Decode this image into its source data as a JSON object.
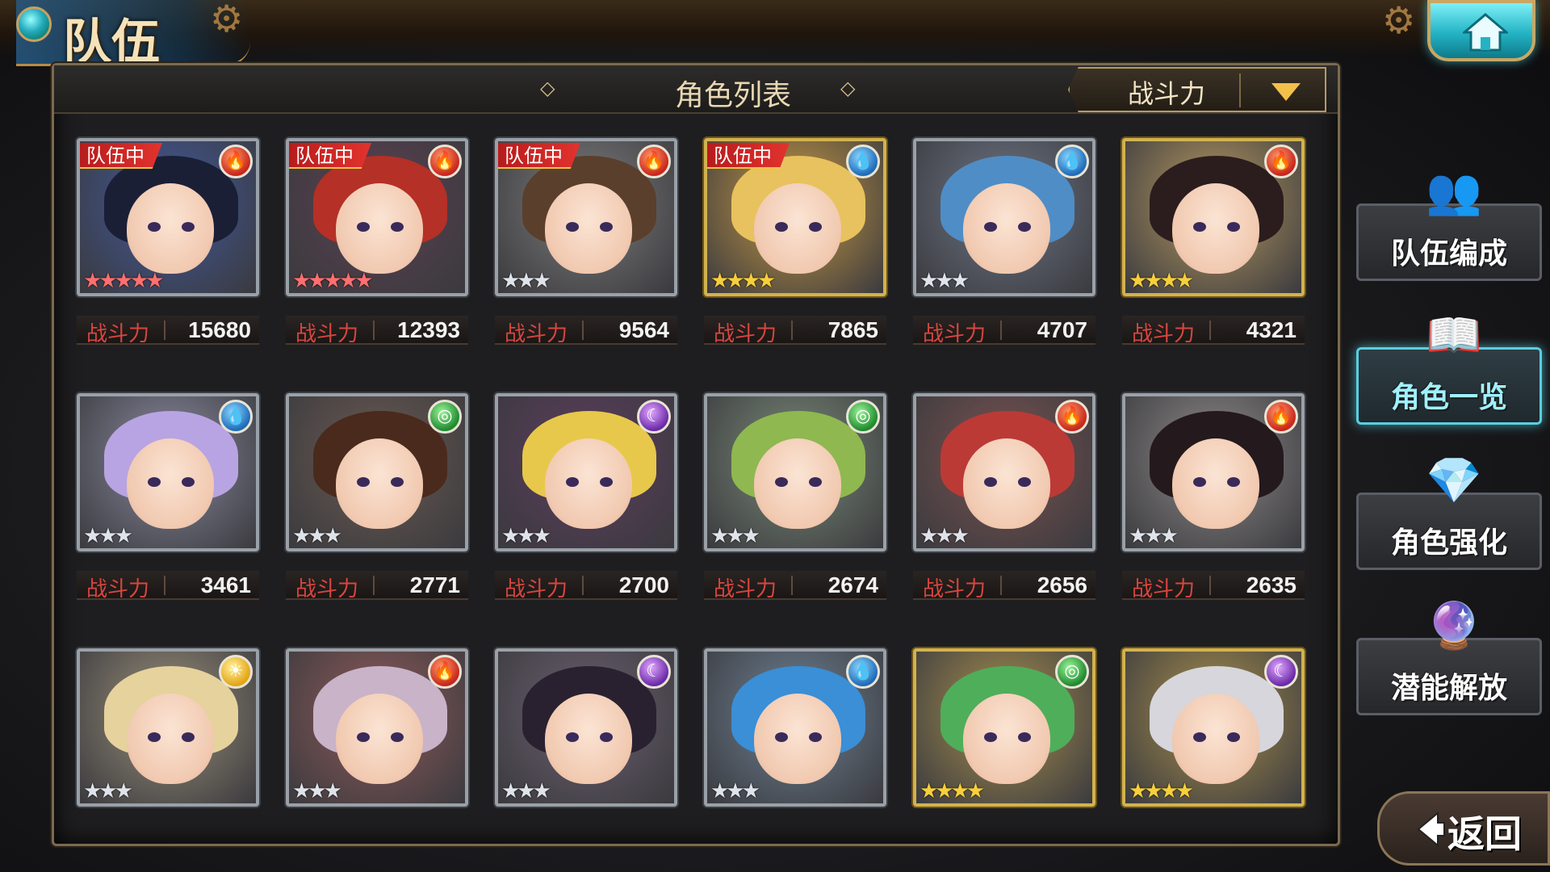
{
  "header": {
    "title": "队伍"
  },
  "panel": {
    "title": "角色列表",
    "sort_label": "战斗力"
  },
  "power_label": "战斗力",
  "team_tag": "队伍中",
  "rows": [
    [
      {
        "power": "15680",
        "in_team": true,
        "element": "fire",
        "stars": 5,
        "rarity": "rainbow",
        "hair": "#1a1f36",
        "bg": "#41589a"
      },
      {
        "power": "12393",
        "in_team": true,
        "element": "fire",
        "stars": 5,
        "rarity": "rainbow",
        "hair": "#b53026",
        "bg": "#5a4050"
      },
      {
        "power": "9564",
        "in_team": true,
        "element": "fire",
        "stars": 3,
        "rarity": "silver",
        "hair": "#5a3f2c",
        "bg": "#7c7c7c"
      },
      {
        "power": "7865",
        "in_team": true,
        "element": "water",
        "stars": 4,
        "rarity": "gold",
        "hair": "#e8c25e",
        "bg": "#c89a45"
      },
      {
        "power": "4707",
        "in_team": false,
        "element": "water",
        "stars": 3,
        "rarity": "silver",
        "hair": "#4f8dc6",
        "bg": "#6d7585"
      },
      {
        "power": "4321",
        "in_team": false,
        "element": "fire",
        "stars": 4,
        "rarity": "gold",
        "hair": "#2b1d1d",
        "bg": "#b79a62"
      }
    ],
    [
      {
        "power": "3461",
        "in_team": false,
        "element": "water",
        "stars": 3,
        "rarity": "silver",
        "hair": "#b8a4e2",
        "bg": "#8a8aa0"
      },
      {
        "power": "2771",
        "in_team": false,
        "element": "wind",
        "stars": 3,
        "rarity": "silver",
        "hair": "#4a2a1c",
        "bg": "#6a5a52"
      },
      {
        "power": "2700",
        "in_team": false,
        "element": "dark",
        "stars": 3,
        "rarity": "silver",
        "hair": "#e7c84a",
        "bg": "#5d3c5e"
      },
      {
        "power": "2674",
        "in_team": false,
        "element": "wind",
        "stars": 3,
        "rarity": "silver",
        "hair": "#8fb850",
        "bg": "#7a8a78"
      },
      {
        "power": "2656",
        "in_team": false,
        "element": "fire",
        "stars": 3,
        "rarity": "silver",
        "hair": "#bb3a36",
        "bg": "#7a5250"
      },
      {
        "power": "2635",
        "in_team": false,
        "element": "fire",
        "stars": 3,
        "rarity": "silver",
        "hair": "#24191c",
        "bg": "#8e8a88"
      }
    ],
    [
      {
        "in_team": false,
        "element": "light",
        "stars": 3,
        "rarity": "silver",
        "hair": "#e6d29c",
        "bg": "#9a8f7a"
      },
      {
        "in_team": false,
        "element": "fire",
        "stars": 3,
        "rarity": "silver",
        "hair": "#c9b3c8",
        "bg": "#8f5a5a"
      },
      {
        "in_team": false,
        "element": "dark",
        "stars": 3,
        "rarity": "silver",
        "hair": "#2a2130",
        "bg": "#6b5f6f"
      },
      {
        "in_team": false,
        "element": "water",
        "stars": 3,
        "rarity": "silver",
        "hair": "#3a8fd6",
        "bg": "#6e8295"
      },
      {
        "in_team": false,
        "element": "wind",
        "stars": 4,
        "rarity": "gold",
        "hair": "#4fae5a",
        "bg": "#a89050"
      },
      {
        "in_team": false,
        "element": "dark",
        "stars": 4,
        "rarity": "gold",
        "hair": "#d6d6dc",
        "bg": "#a8904e"
      }
    ]
  ],
  "side_menu": [
    {
      "label": "队伍编成",
      "icon": "team-chibi-icon",
      "active": false
    },
    {
      "label": "角色一览",
      "icon": "book-icon",
      "active": true
    },
    {
      "label": "角色强化",
      "icon": "crystal-icon",
      "active": false
    },
    {
      "label": "潜能解放",
      "icon": "orb-icon",
      "active": false
    }
  ],
  "back": {
    "label": "返回"
  },
  "element_glyphs": {
    "fire": "🔥",
    "water": "💧",
    "wind": "◎",
    "dark": "☾",
    "light": "☀"
  }
}
